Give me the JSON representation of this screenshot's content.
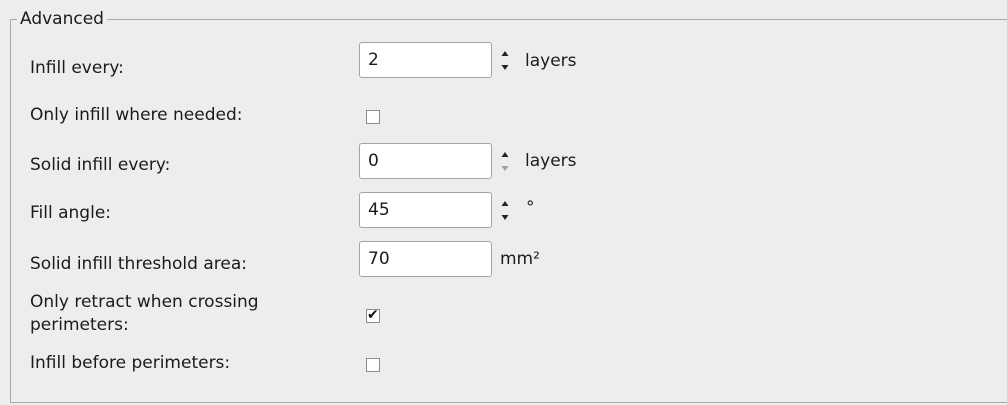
{
  "group": {
    "title": "Advanced"
  },
  "fields": {
    "infill_every": {
      "label": "Infill every:",
      "value": "2",
      "unit": "layers"
    },
    "only_infill_where_needed": {
      "label": "Only infill where needed:",
      "checked": false
    },
    "solid_infill_every": {
      "label": "Solid infill every:",
      "value": "0",
      "unit": "layers"
    },
    "fill_angle": {
      "label": "Fill angle:",
      "value": "45",
      "unit": "°"
    },
    "solid_infill_threshold_area": {
      "label": "Solid infill threshold area:",
      "value": "70",
      "unit": "mm²"
    },
    "only_retract_when_crossing_perimeters": {
      "label_line1": "Only retract when crossing",
      "label_line2": "perimeters:",
      "checked": true,
      "check_glyph": "✔"
    },
    "infill_before_perimeters": {
      "label": "Infill before perimeters:",
      "checked": false
    }
  },
  "icons": {
    "spin_up": "spin-up-icon",
    "spin_down": "spin-down-icon",
    "checkmark": "checkmark-icon"
  }
}
